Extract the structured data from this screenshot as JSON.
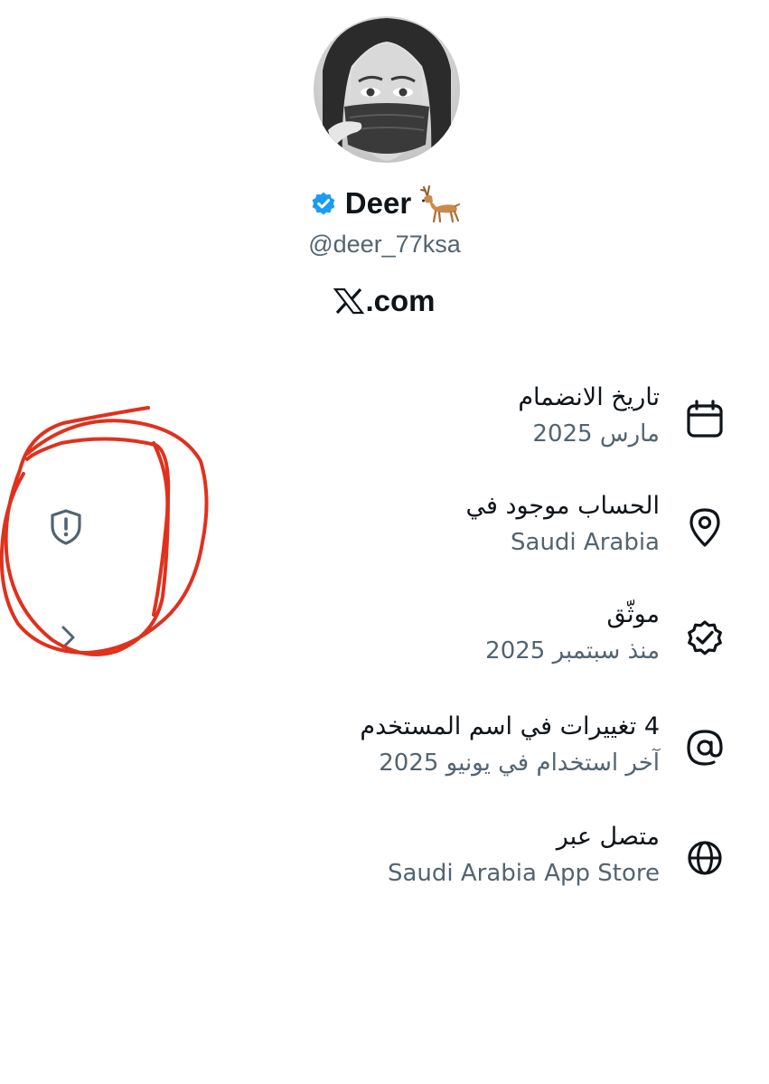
{
  "profile": {
    "display_name": "Deer",
    "handle": "@deer_77ksa",
    "domain": ".com",
    "domain_logo": "x-logo",
    "emoji": "deer-emoji",
    "verified_color": "#1d9bf0"
  },
  "info_rows": [
    {
      "icon": "calendar-icon",
      "title": "تاريخ الانضمام",
      "subtitle": "مارس 2025"
    },
    {
      "icon": "location-pin-icon",
      "title": "الحساب موجود في",
      "subtitle": "Saudi Arabia"
    },
    {
      "icon": "verified-seal-icon",
      "title": "موثّق",
      "subtitle": "منذ سبتمبر 2025"
    },
    {
      "icon": "at-sign-icon",
      "title": "4 تغييرات في اسم المستخدم",
      "subtitle": "آخر استخدام في يونيو 2025"
    },
    {
      "icon": "globe-icon",
      "title": "متصل عبر",
      "subtitle": "Saudi Arabia App Store"
    }
  ],
  "side": {
    "shield_icon": "shield-alert-icon",
    "chevron_icon": "chevron-right-icon",
    "annotation_color": "#e0311d"
  },
  "colors": {
    "text_primary": "#0f1419",
    "text_secondary": "#536471",
    "background": "#ffffff"
  }
}
